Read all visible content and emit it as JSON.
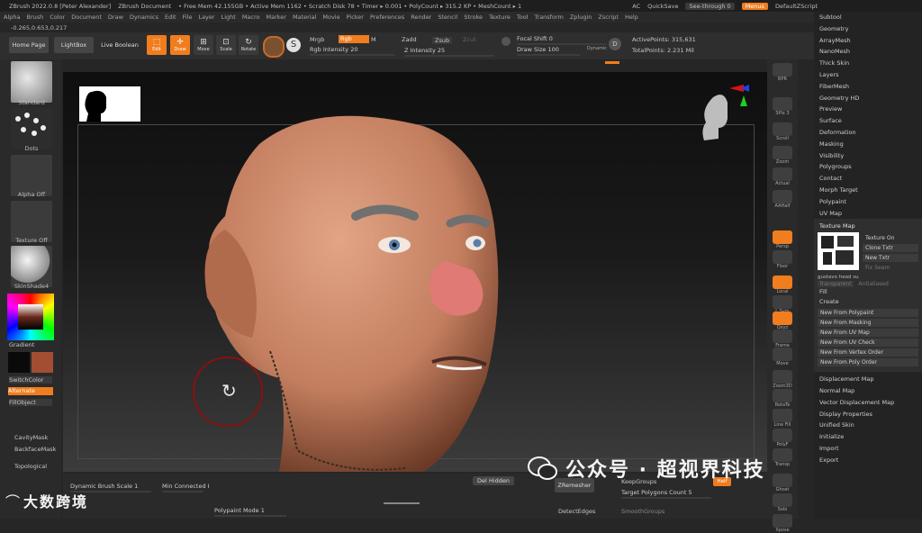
{
  "titlebar": {
    "app": "ZBrush 2022.0.8 [Peter Alexander]",
    "document": "ZBrush Document",
    "stats": "• Free Mem 42.155GB • Active Mem 1162 • Scratch Disk 78 • Timer ▸ 0.001 • PolyCount ▸ 315.2 KP • MeshCount ▸ 1",
    "ac": "AC",
    "quicksave": "QuickSave",
    "seethrough": "See-through  0",
    "menus": "Menus",
    "defaultzscript": "DefaultZScript"
  },
  "menubar": [
    "Alpha",
    "Brush",
    "Color",
    "Document",
    "Draw",
    "Dynamics",
    "Edit",
    "File",
    "Layer",
    "Light",
    "Macro",
    "Marker",
    "Material",
    "Movie",
    "Picker",
    "Preferences",
    "Render",
    "Stencil",
    "Stroke",
    "Texture",
    "Tool",
    "Transform",
    "Zplugin",
    "Zscript",
    "Help"
  ],
  "coords": "-0.265,0.653,0.217",
  "toolbar": {
    "home": "Home Page",
    "lightbox": "LightBox",
    "liveboolean": "Live Boolean",
    "edit": "Edit",
    "draw": "Draw",
    "move": "Move",
    "scale": "Scale",
    "rotate": "Rotate",
    "mrgb": "Mrgb",
    "rgb": "Rgb",
    "m": "M",
    "rgb_intensity": "Rgb Intensity 20",
    "zadd": "Zadd",
    "zsub": "Zsub",
    "zcut": "Zcut",
    "z_intensity": "Z Intensity 25",
    "focal_shift": "Focal Shift 0",
    "draw_size": "Draw Size 100",
    "dynamic": "Dynamic",
    "active_points": "ActivePoints: 315,631",
    "total_points": "TotalPoints: 2.231 Mil"
  },
  "left": {
    "brush": "Standard",
    "stroke": "Dots",
    "alpha": "Alpha Off",
    "texture": "Texture Off",
    "material": "SkinShade4",
    "gradient": "Gradient",
    "switchcolor": "SwitchColor",
    "alternate": "Alternate",
    "fillobject": "FillObject",
    "cavitymask": "CavityMask",
    "backfacemask": "BackfaceMask",
    "topological": "Topological",
    "colors": {
      "main": "#0a0a0a",
      "secondary": "#a34d33"
    }
  },
  "right_shelf": [
    "BPR",
    "SPix 3",
    "Scroll",
    "Zoom",
    "Actual",
    "AAHalf",
    "Persp",
    "Floor",
    "Local",
    "L.Sym",
    "Qxyz",
    "Frame",
    "Move",
    "Zoom3D",
    "RotaTe",
    "Line Fill",
    "PolyF",
    "Transp",
    "Ghost",
    "Solo",
    "Xpose"
  ],
  "right_panel": {
    "top_items": [
      "Subtool",
      "Geometry",
      "ArrayMesh",
      "NanoMesh",
      "Thick Skin",
      "Layers",
      "FiberMesh",
      "Geometry HD",
      "Preview",
      "Surface",
      "Deformation",
      "Masking",
      "Visibility",
      "Polygroups",
      "Contact",
      "Morph Target",
      "Polypaint",
      "UV Map"
    ],
    "texture_map": "Texture Map",
    "texture_on": "Texture On",
    "clone_txtr": "Clone Txtr",
    "new_txtr": "New Txtr",
    "fix_seam": "Fix Seam",
    "transparent": "Transparent",
    "antialiased": "Antialiased",
    "texture_name": "gustavo head su",
    "fill": "Fill",
    "create": "Create",
    "create_items": [
      "New From Polypaint",
      "New From Masking",
      "New From UV Map",
      "New From UV Check",
      "New From Vertex Order",
      "New From Poly Order"
    ],
    "bottom_items": [
      "Displacement Map",
      "Normal Map",
      "Vector Displacement Map",
      "Display Properties",
      "Unified Skin",
      "Initialize",
      "Import",
      "Export"
    ]
  },
  "bottom": {
    "dyn_brush_scale": "Dynamic Brush Scale 1",
    "min_connected": "Min Connected I",
    "polypaint_mode": "Polypaint Mode 1",
    "del_hidden": "Del Hidden",
    "zremesher": "ZRemesher",
    "keepgroups": "KeepGroups",
    "target_polygons": "Target Polygons Count 5",
    "detectedges": "DetectEdges",
    "smoothgroups": "SmoothGroups",
    "half": "Half"
  },
  "watermark": {
    "left": "大数跨境",
    "right": "公众号 · 超视界科技"
  }
}
